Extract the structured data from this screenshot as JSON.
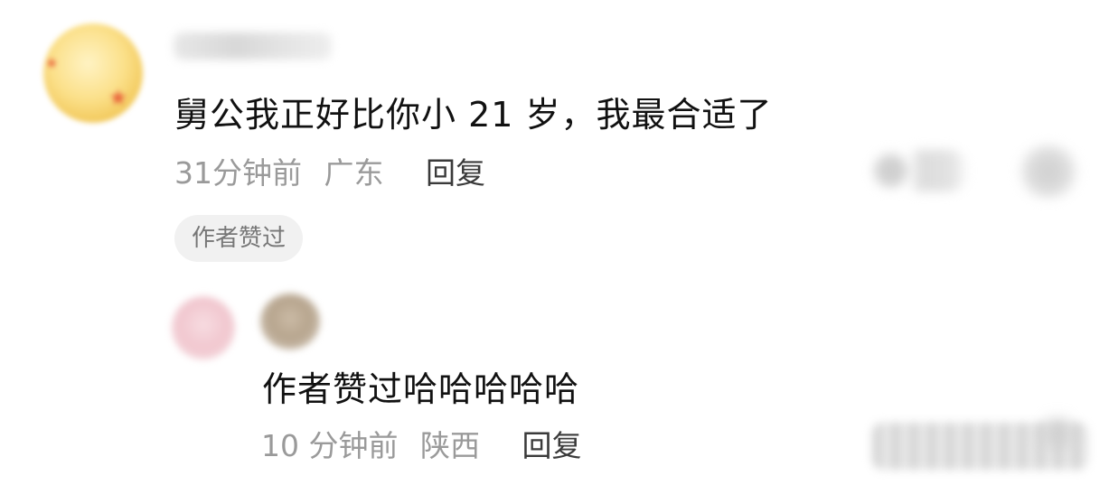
{
  "comment": {
    "text": "舅公我正好比你小 21 岁，我最合适了",
    "time": "31分钟前",
    "location": "广东",
    "reply_label": "回复",
    "badge": "作者赞过"
  },
  "reply": {
    "text": "作者赞过哈哈哈哈哈",
    "time": "10 分钟前",
    "location": "陕西",
    "reply_label": "回复"
  }
}
